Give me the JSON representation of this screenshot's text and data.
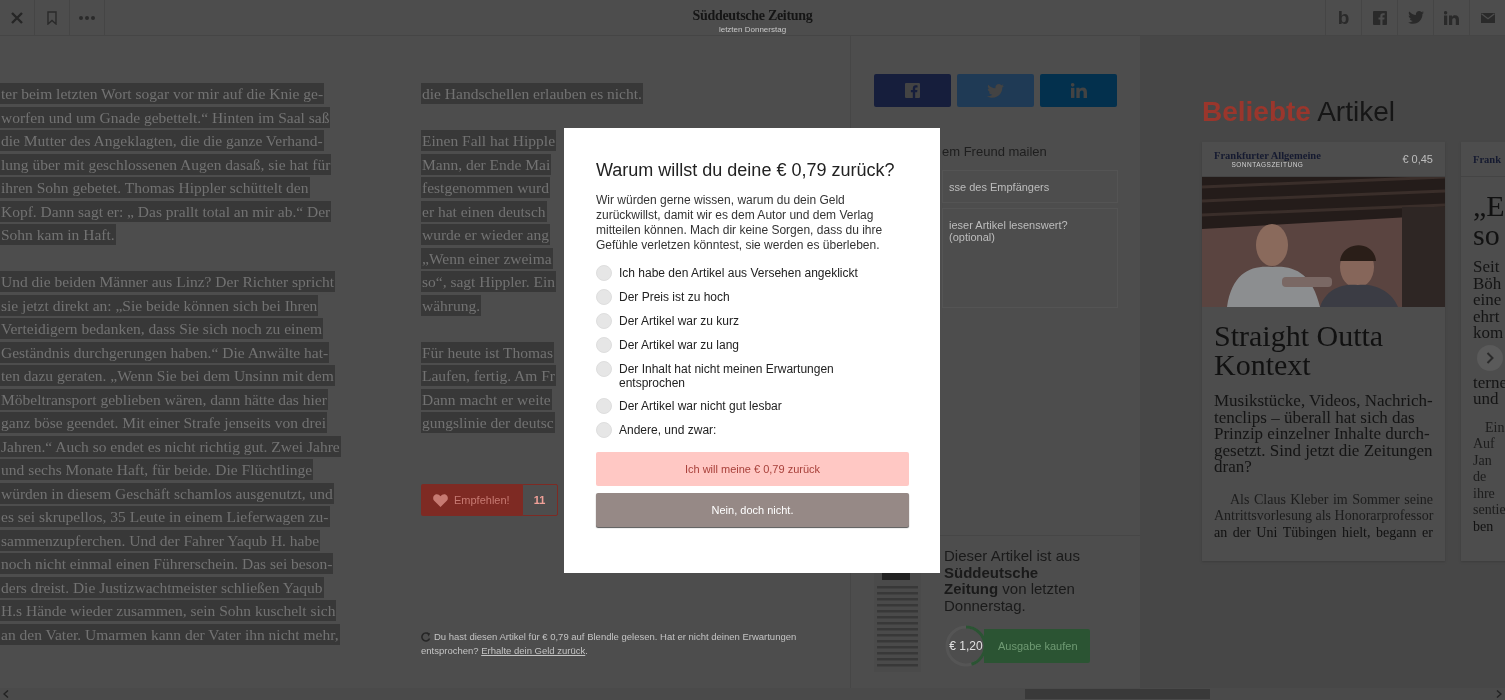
{
  "top_bar": {
    "publication": "Süddeutsche Zeitung",
    "date": "letzten Donnerstag",
    "brand_mark": "b"
  },
  "article": {
    "column_1": [
      {
        "highlighted": true,
        "lines": [
          "ter beim letzten Wort sogar vor mir auf die Knie ge-",
          "worfen und um Gnade gebettelt.“ Hinten im Saal saß",
          "die Mutter des Angeklagten, die die ganze Verhand-",
          "lung über mit geschlossenen Augen dasaß, sie hat für",
          "ihren Sohn gebetet. Thomas Hippler schüttelt den",
          "Kopf. Dann sagt er: „ Das prallt total an mir ab.“ Der",
          "Sohn kam in Haft."
        ]
      },
      {
        "highlighted": true,
        "lines": [
          "Und die beiden Männer aus Linz? Der Richter spricht",
          "sie jetzt direkt an: „Sie beide können sich bei Ihren",
          "Verteidigern bedanken, dass Sie sich noch zu einem",
          "Geständnis durchgerungen haben.“ Die Anwälte hat-",
          "ten dazu geraten. „Wenn Sie bei dem Unsinn mit dem",
          "Möbeltransport geblieben wären, dann hätte das hier",
          "ganz böse geendet. Mit einer Strafe jenseits von drei",
          "Jahren.“ Auch so endet es nicht richtig gut. Zwei Jahre",
          "und sechs Monate Haft, für beide. Die Flüchtlinge",
          "würden in diesem Geschäft schamlos ausgenutzt, und",
          "es sei skrupellos, 35 Leute in einem Lieferwagen zu-",
          "sammenzupferchen. Und der Fahrer Yaqub H. habe",
          "noch nicht einmal einen Führerschein. Das sei beson-",
          "ders dreist. Die Justizwachtmeister schließen Yaqub",
          "H.s Hände wieder zusammen, sein Sohn kuschelt sich",
          "an den Vater. Umarmen kann der Vater ihn nicht mehr,"
        ]
      }
    ],
    "column_2": [
      {
        "highlighted": true,
        "lines": [
          "die Handschellen erlauben es nicht."
        ]
      },
      {
        "highlighted": true,
        "lines": [
          "Einen Fall hat Hipple",
          "Mann, der Ende Mai",
          "festgenommen wurd",
          "er hat einen deutsch",
          "wurde er wieder ang",
          "„Wenn einer zweima",
          "so“, sagt Hippler. Ein",
          "währung."
        ]
      },
      {
        "highlighted": true,
        "lines": [
          "Für heute ist Thomas",
          "Laufen, fertig. Am Fr",
          "Dann macht er weite",
          "gungslinie der deutsc"
        ]
      }
    ],
    "recommend": {
      "label": "Empfehlen!",
      "count": "11"
    },
    "refund_note": {
      "before": "Du hast diesen Artikel für € 0,79 auf Blendle gelesen. Hat er nicht deinen Erwartungen entsprochen? ",
      "link": "Erhalte dein Geld zurück",
      "after": "."
    }
  },
  "share_panel": {
    "email": {
      "label": "em Freund mailen",
      "fields": [
        {
          "placeholder": "sse des Empfängers",
          "kind": "input"
        },
        {
          "placeholder": "ieser Artikel lesenswert? (optional)",
          "kind": "textarea"
        }
      ]
    },
    "issue": {
      "text": "Dieser Artikel ist aus **Süddeutsche Zeitung** von letzten Donnerstag.",
      "price": "€ 1,20",
      "level": 0.45,
      "buy_button": "Ausgabe kaufen"
    }
  },
  "popular": {
    "title_accent": "Beliebte",
    "title_rest": "Artikel",
    "cards": [
      {
        "publication": "Frankfurter Allgemeine",
        "publication_sub": "SONNTAGSZEITUNG",
        "price": "€ 0,45",
        "image": {
          "kind": "picture"
        },
        "title": "Straight Outta Kontext",
        "dek_lines": [
          "Musikstücke, Videos, Nachrich-",
          "tenclips – überall hat sich das",
          "Prinzip einzelner Inhalte durch-",
          "gesetzt. Sind jetzt die Zeitungen",
          "dran?"
        ],
        "body_lines": [
          "Als Claus Kleber im Sommer seine",
          "Antrittsvorlesung als Honorarprofessor",
          "an der Uni Tübingen hielt, begann er"
        ]
      },
      {
        "publication": "Frank",
        "title_lines": [
          "„E",
          "so"
        ],
        "dek_lines_top": [
          "Seit",
          "Böh",
          "eine",
          "ehrt",
          "kom"
        ],
        "dek_lines_bottom": [
          "terne",
          "und"
        ],
        "body_lines": [
          "Ein",
          "Auf",
          "Jan",
          "de",
          "ihre",
          "sentie",
          "ben"
        ]
      }
    ]
  },
  "dialog": {
    "title": "Warum willst du deine € 0,79 zurück?",
    "text": "Wir würden gerne wissen, warum du dein Geld zurückwillst, damit wir es dem Autor und dem Verlag mitteilen können. Mach dir keine Sorgen, dass du ihre Gefühle verletzen könntest, sie werden es überleben.",
    "options": [
      {
        "label": "Ich habe den Artikel aus Versehen angeklickt",
        "selected": false
      },
      {
        "label": "Der Preis ist zu hoch",
        "selected": false
      },
      {
        "label": "Der Artikel war zu kurz",
        "selected": false
      },
      {
        "label": "Der Artikel war zu lang",
        "selected": false
      },
      {
        "label": "Der Inhalt hat nicht meinen Erwartungen entsprochen",
        "selected": false
      },
      {
        "label": "Der Artikel war nicht gut lesbar",
        "selected": false
      },
      {
        "label": "Andere, und zwar:",
        "selected": false
      }
    ],
    "confirm_button": {
      "label": "Ich will meine € 0,79 zurück",
      "disabled": true
    },
    "cancel_button": {
      "label": "Nein, doch nicht."
    }
  }
}
